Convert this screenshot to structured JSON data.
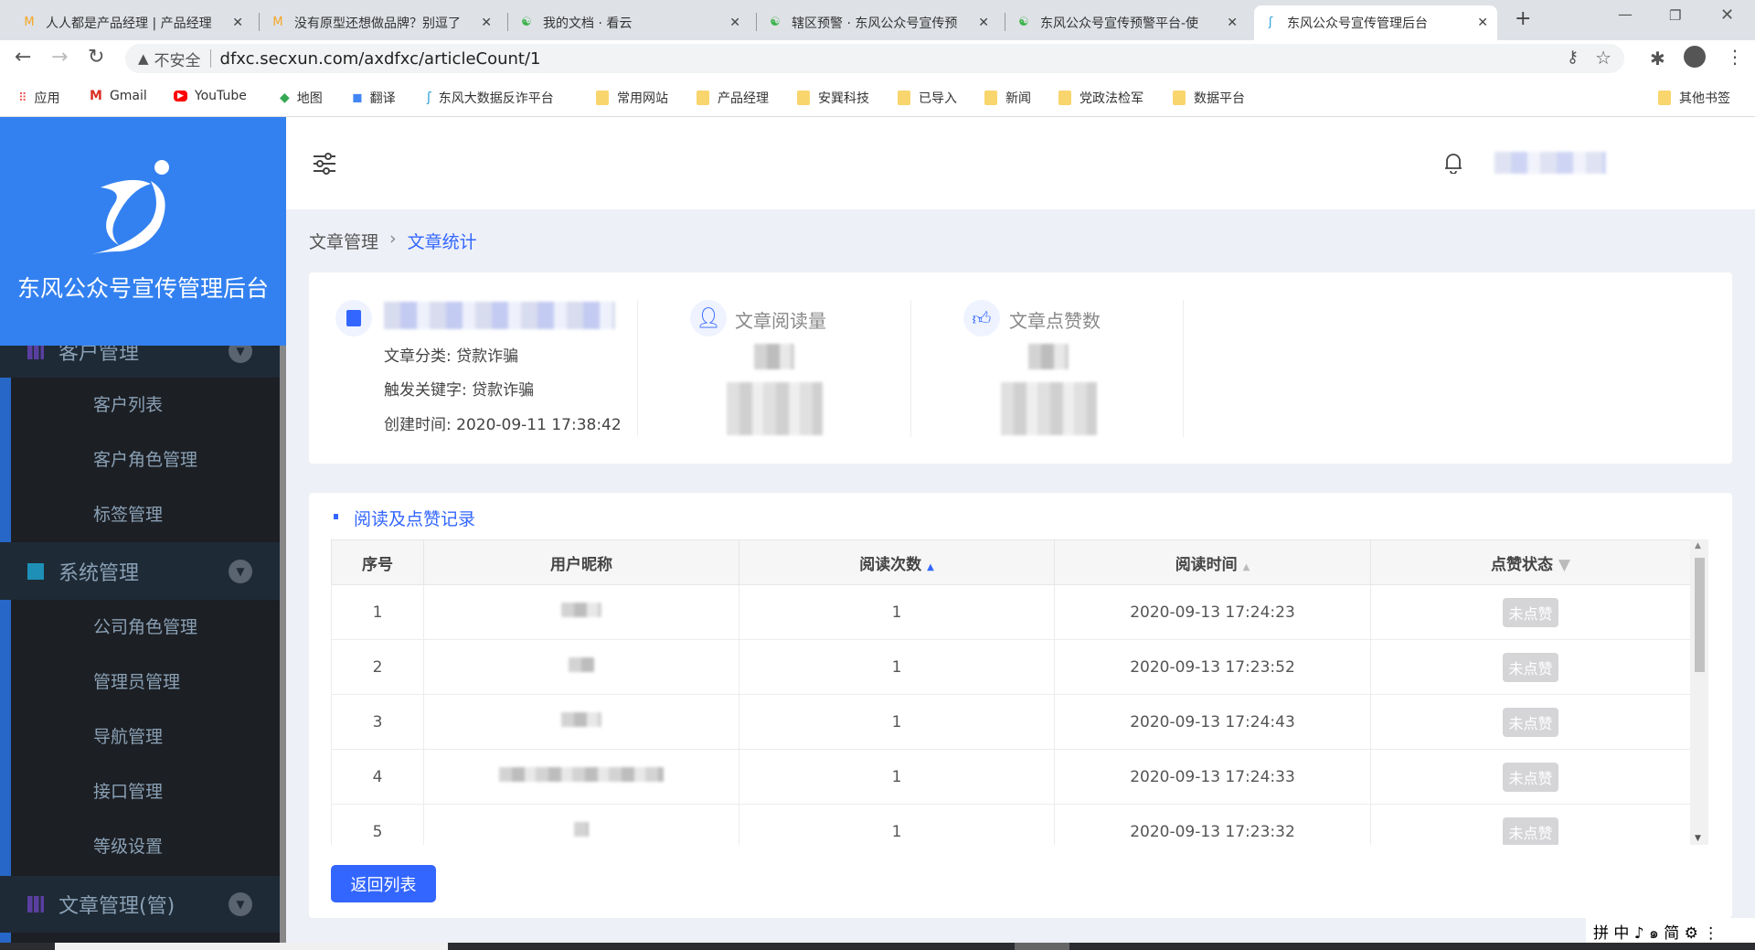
{
  "browser": {
    "tabs": [
      {
        "title": "人人都是产品经理 | 产品经理"
      },
      {
        "title": "没有原型还想做品牌？别逗了"
      },
      {
        "title": "我的文档 · 看云"
      },
      {
        "title": "辖区预警 · 东风公众号宣传预"
      },
      {
        "title": "东风公众号宣传预警平台-使"
      },
      {
        "title": "东风公众号宣传管理后台",
        "active": true
      }
    ],
    "security": "不安全",
    "url": "dfxc.secxun.com/axdfxc/articleCount/1",
    "bookmarks": [
      "应用",
      "Gmail",
      "YouTube",
      "地图",
      "翻译",
      "东风大数据反诈平台",
      "常用网站",
      "产品经理",
      "安巽科技",
      "已导入",
      "新闻",
      "党政法检军",
      "数据平台"
    ],
    "other_bookmarks": "其他书签"
  },
  "sidebar": {
    "app_title": "东风公众号宣传管理后台",
    "groups": [
      {
        "label": "客户管理",
        "items": [
          "客户列表",
          "客户角色管理",
          "标签管理"
        ]
      },
      {
        "label": "系统管理",
        "items": [
          "公司角色管理",
          "管理员管理",
          "导航管理",
          "接口管理",
          "等级设置"
        ]
      },
      {
        "label": "文章管理(管)",
        "items": []
      }
    ]
  },
  "breadcrumb": {
    "parent": "文章管理",
    "current": "文章统计"
  },
  "article": {
    "category": "文章分类: 贷款诈骗",
    "keyword": "触发关键字: 贷款诈骗",
    "created": "创建时间: 2020-09-11 17:38:42",
    "reads_label": "文章阅读量",
    "likes_label": "文章点赞数"
  },
  "records": {
    "title": "阅读及点赞记录",
    "columns": [
      "序号",
      "用户昵称",
      "阅读次数",
      "阅读时间",
      "点赞状态"
    ],
    "rows": [
      {
        "no": "1",
        "count": "1",
        "time": "2020-09-13 17:24:23",
        "status": "未点赞"
      },
      {
        "no": "2",
        "count": "1",
        "time": "2020-09-13 17:23:52",
        "status": "未点赞"
      },
      {
        "no": "3",
        "count": "1",
        "time": "2020-09-13 17:24:43",
        "status": "未点赞"
      },
      {
        "no": "4",
        "count": "1",
        "time": "2020-09-13 17:24:33",
        "status": "未点赞"
      },
      {
        "no": "5",
        "count": "1",
        "time": "2020-09-13 17:23:32",
        "status": "未点赞"
      }
    ],
    "back_label": "返回列表"
  },
  "ime": "拼 中 ♪ ๑ 简 ⚙ ⋮",
  "colors": {
    "brand": "#3381f0",
    "primary_button": "#3366ff",
    "sidebar": "#1c1f24"
  }
}
